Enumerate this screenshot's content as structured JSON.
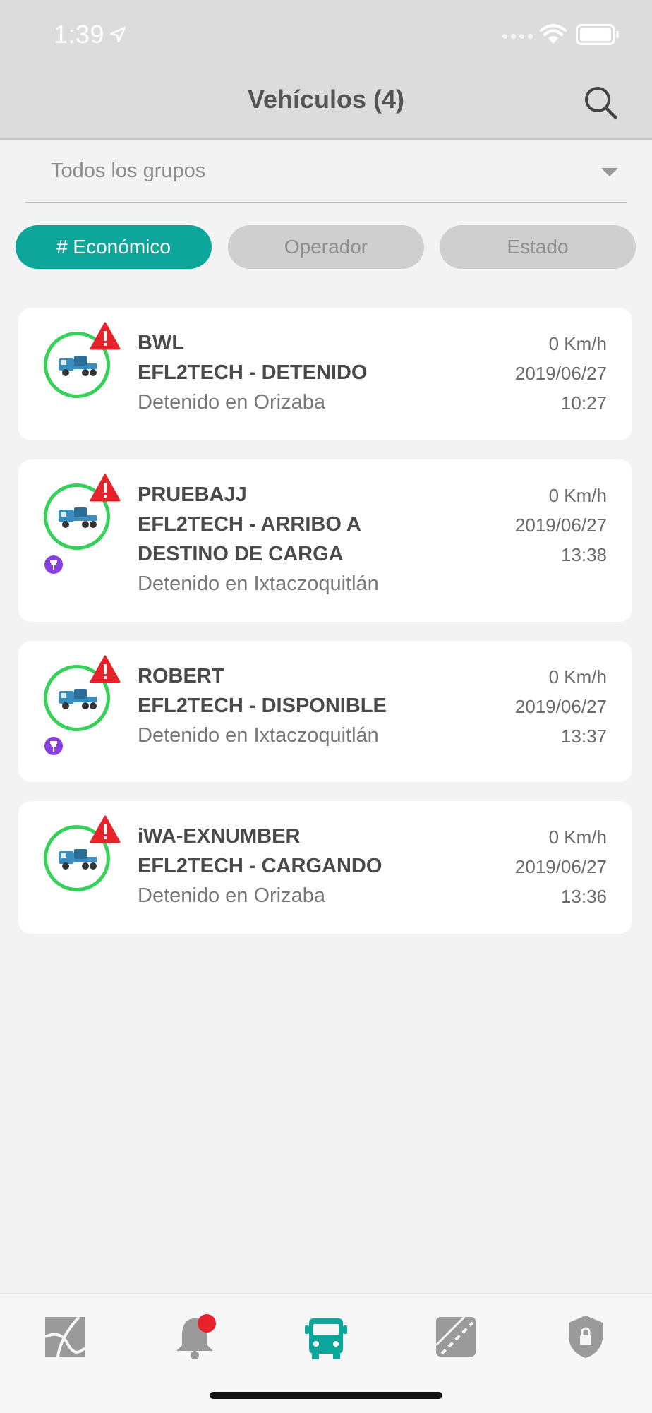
{
  "status_bar": {
    "time": "1:39"
  },
  "header": {
    "title": "Vehículos (4)"
  },
  "group_filter": {
    "selected": "Todos los grupos"
  },
  "filter_chips": [
    "# Económico",
    "Operador",
    "Estado"
  ],
  "vehicles": [
    {
      "name": "BWL",
      "status_line1": "EFL2TECH - DETENIDO",
      "status_line2": "",
      "location": "Detenido en Orizaba",
      "speed": "0 Km/h",
      "date": "2019/06/27",
      "time": "10:27"
    },
    {
      "name": "PRUEBAJJ",
      "status_line1": "EFL2TECH - ARRIBO A",
      "status_line2": "DESTINO DE CARGA",
      "location": "Detenido en Ixtaczoquitlán",
      "speed": "0 Km/h",
      "date": "2019/06/27",
      "time": "13:38"
    },
    {
      "name": "ROBERT",
      "status_line1": "EFL2TECH - DISPONIBLE",
      "status_line2": "",
      "location": "Detenido en Ixtaczoquitlán",
      "speed": "0 Km/h",
      "date": "2019/06/27",
      "time": "13:37"
    },
    {
      "name": "iWA-EXNUMBER",
      "status_line1": "EFL2TECH - CARGANDO",
      "status_line2": "",
      "location": "Detenido en Orizaba",
      "speed": "0 Km/h",
      "date": "2019/06/27",
      "time": "13:36"
    }
  ],
  "tabbar": {
    "tabs": [
      "map-icon",
      "bell-icon",
      "truck-icon",
      "road-icon",
      "shield-lock-icon"
    ],
    "active": "truck-icon"
  },
  "colors": {
    "accent": "#0ea69b",
    "online_ring": "#36d158",
    "alert": "#e8222b",
    "pin": "#8a3fe0"
  }
}
